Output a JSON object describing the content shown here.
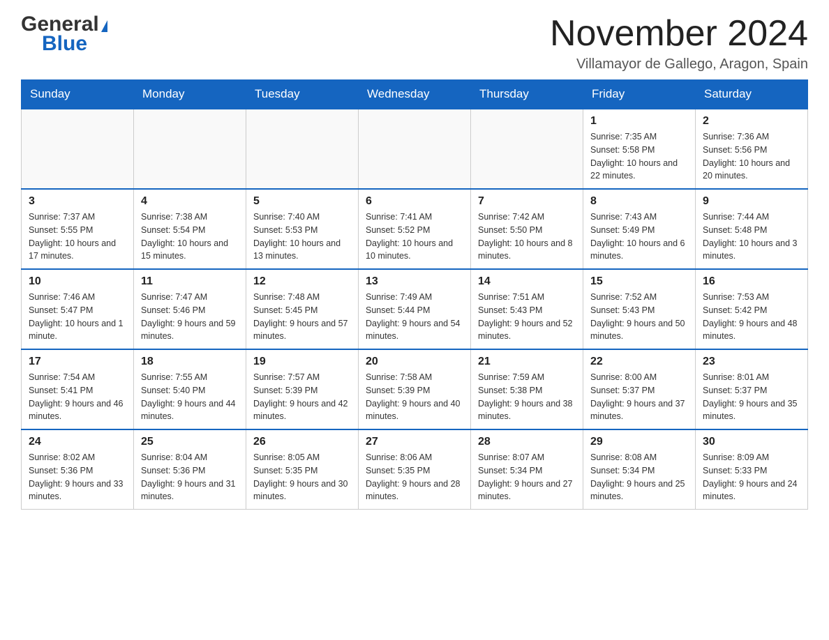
{
  "logo": {
    "general": "General",
    "blue": "Blue"
  },
  "header": {
    "month_title": "November 2024",
    "location": "Villamayor de Gallego, Aragon, Spain"
  },
  "days_of_week": [
    "Sunday",
    "Monday",
    "Tuesday",
    "Wednesday",
    "Thursday",
    "Friday",
    "Saturday"
  ],
  "weeks": [
    [
      {
        "day": "",
        "info": ""
      },
      {
        "day": "",
        "info": ""
      },
      {
        "day": "",
        "info": ""
      },
      {
        "day": "",
        "info": ""
      },
      {
        "day": "",
        "info": ""
      },
      {
        "day": "1",
        "info": "Sunrise: 7:35 AM\nSunset: 5:58 PM\nDaylight: 10 hours and 22 minutes."
      },
      {
        "day": "2",
        "info": "Sunrise: 7:36 AM\nSunset: 5:56 PM\nDaylight: 10 hours and 20 minutes."
      }
    ],
    [
      {
        "day": "3",
        "info": "Sunrise: 7:37 AM\nSunset: 5:55 PM\nDaylight: 10 hours and 17 minutes."
      },
      {
        "day": "4",
        "info": "Sunrise: 7:38 AM\nSunset: 5:54 PM\nDaylight: 10 hours and 15 minutes."
      },
      {
        "day": "5",
        "info": "Sunrise: 7:40 AM\nSunset: 5:53 PM\nDaylight: 10 hours and 13 minutes."
      },
      {
        "day": "6",
        "info": "Sunrise: 7:41 AM\nSunset: 5:52 PM\nDaylight: 10 hours and 10 minutes."
      },
      {
        "day": "7",
        "info": "Sunrise: 7:42 AM\nSunset: 5:50 PM\nDaylight: 10 hours and 8 minutes."
      },
      {
        "day": "8",
        "info": "Sunrise: 7:43 AM\nSunset: 5:49 PM\nDaylight: 10 hours and 6 minutes."
      },
      {
        "day": "9",
        "info": "Sunrise: 7:44 AM\nSunset: 5:48 PM\nDaylight: 10 hours and 3 minutes."
      }
    ],
    [
      {
        "day": "10",
        "info": "Sunrise: 7:46 AM\nSunset: 5:47 PM\nDaylight: 10 hours and 1 minute."
      },
      {
        "day": "11",
        "info": "Sunrise: 7:47 AM\nSunset: 5:46 PM\nDaylight: 9 hours and 59 minutes."
      },
      {
        "day": "12",
        "info": "Sunrise: 7:48 AM\nSunset: 5:45 PM\nDaylight: 9 hours and 57 minutes."
      },
      {
        "day": "13",
        "info": "Sunrise: 7:49 AM\nSunset: 5:44 PM\nDaylight: 9 hours and 54 minutes."
      },
      {
        "day": "14",
        "info": "Sunrise: 7:51 AM\nSunset: 5:43 PM\nDaylight: 9 hours and 52 minutes."
      },
      {
        "day": "15",
        "info": "Sunrise: 7:52 AM\nSunset: 5:43 PM\nDaylight: 9 hours and 50 minutes."
      },
      {
        "day": "16",
        "info": "Sunrise: 7:53 AM\nSunset: 5:42 PM\nDaylight: 9 hours and 48 minutes."
      }
    ],
    [
      {
        "day": "17",
        "info": "Sunrise: 7:54 AM\nSunset: 5:41 PM\nDaylight: 9 hours and 46 minutes."
      },
      {
        "day": "18",
        "info": "Sunrise: 7:55 AM\nSunset: 5:40 PM\nDaylight: 9 hours and 44 minutes."
      },
      {
        "day": "19",
        "info": "Sunrise: 7:57 AM\nSunset: 5:39 PM\nDaylight: 9 hours and 42 minutes."
      },
      {
        "day": "20",
        "info": "Sunrise: 7:58 AM\nSunset: 5:39 PM\nDaylight: 9 hours and 40 minutes."
      },
      {
        "day": "21",
        "info": "Sunrise: 7:59 AM\nSunset: 5:38 PM\nDaylight: 9 hours and 38 minutes."
      },
      {
        "day": "22",
        "info": "Sunrise: 8:00 AM\nSunset: 5:37 PM\nDaylight: 9 hours and 37 minutes."
      },
      {
        "day": "23",
        "info": "Sunrise: 8:01 AM\nSunset: 5:37 PM\nDaylight: 9 hours and 35 minutes."
      }
    ],
    [
      {
        "day": "24",
        "info": "Sunrise: 8:02 AM\nSunset: 5:36 PM\nDaylight: 9 hours and 33 minutes."
      },
      {
        "day": "25",
        "info": "Sunrise: 8:04 AM\nSunset: 5:36 PM\nDaylight: 9 hours and 31 minutes."
      },
      {
        "day": "26",
        "info": "Sunrise: 8:05 AM\nSunset: 5:35 PM\nDaylight: 9 hours and 30 minutes."
      },
      {
        "day": "27",
        "info": "Sunrise: 8:06 AM\nSunset: 5:35 PM\nDaylight: 9 hours and 28 minutes."
      },
      {
        "day": "28",
        "info": "Sunrise: 8:07 AM\nSunset: 5:34 PM\nDaylight: 9 hours and 27 minutes."
      },
      {
        "day": "29",
        "info": "Sunrise: 8:08 AM\nSunset: 5:34 PM\nDaylight: 9 hours and 25 minutes."
      },
      {
        "day": "30",
        "info": "Sunrise: 8:09 AM\nSunset: 5:33 PM\nDaylight: 9 hours and 24 minutes."
      }
    ]
  ]
}
